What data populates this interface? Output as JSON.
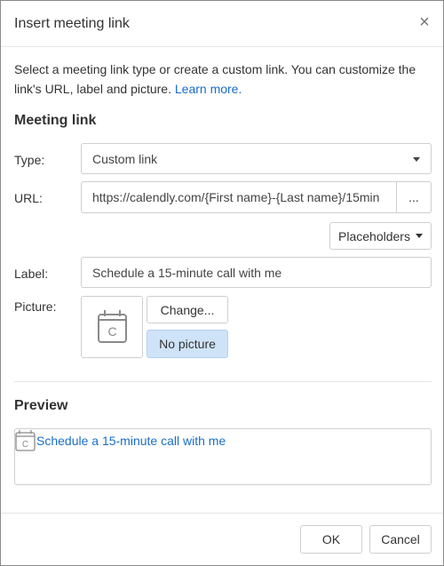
{
  "dialog": {
    "title": "Insert meeting link",
    "close_icon": "close-icon"
  },
  "intro": {
    "text": "Select a meeting link type or create a custom link. You can customize the link's URL, label and picture.",
    "learn_more": "Learn more."
  },
  "meeting_link": {
    "section_title": "Meeting link",
    "type_label": "Type:",
    "type_value": "Custom link",
    "url_label": "URL:",
    "url_value": "https://calendly.com/{First name}-{Last name}/15min",
    "url_more_button": "...",
    "placeholders_button": "Placeholders",
    "label_label": "Label:",
    "label_value": "Schedule a 15-minute call with me",
    "picture_label": "Picture:",
    "picture_icon": "calendar-icon",
    "picture_icon_letter": "C",
    "change_button": "Change...",
    "no_picture_button": "No picture"
  },
  "preview": {
    "section_title": "Preview",
    "link_text": "Schedule a 15-minute call with me",
    "icon": "calendar-icon",
    "icon_letter": "C"
  },
  "footer": {
    "ok_button": "OK",
    "cancel_button": "Cancel"
  },
  "colors": {
    "link": "#1a6ec7",
    "selected_button": "#cfe3f8",
    "border": "#cfcfcf"
  }
}
